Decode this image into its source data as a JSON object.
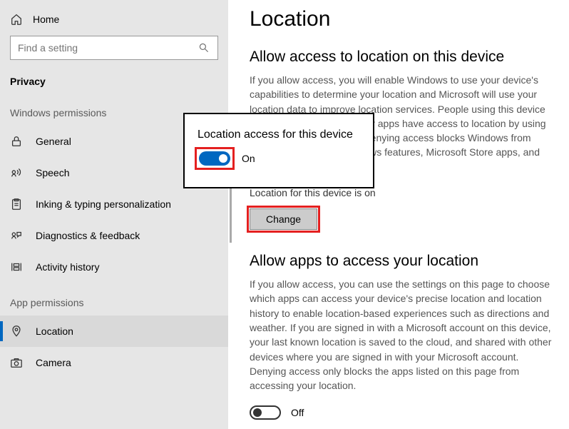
{
  "sidebar": {
    "home": "Home",
    "search_placeholder": "Find a setting",
    "section": "Privacy",
    "group1": "Windows permissions",
    "items1": [
      {
        "label": "General"
      },
      {
        "label": "Speech"
      },
      {
        "label": "Inking & typing personalization"
      },
      {
        "label": "Diagnostics & feedback"
      },
      {
        "label": "Activity history"
      }
    ],
    "group2": "App permissions",
    "items2": [
      {
        "label": "Location"
      },
      {
        "label": "Camera"
      }
    ]
  },
  "main": {
    "title": "Location",
    "section1_title": "Allow access to location on this device",
    "section1_body": "If you allow access, you will enable Windows to use your device's capabilities to determine your location and Microsoft will use your location data to improve location services. People using this device will be able to choose if their apps have access to location by using the settings on this page. Denying access blocks Windows from providing location to Windows features, Microsoft Store apps, and most desktop apps.",
    "status_line": "Location for this device is on",
    "change_btn": "Change",
    "section2_title": "Allow apps to access your location",
    "section2_body": "If you allow access, you can use the settings on this page to choose which apps can access your device's precise location and location history to enable location-based experiences such as directions and weather. If you are signed in with a Microsoft account on this device, your last known location is saved to the cloud, and shared with other devices where you are signed in with your Microsoft account. Denying access only blocks the apps listed on this page from accessing your location.",
    "toggle2_label": "Off"
  },
  "popup": {
    "title": "Location access for this device",
    "toggle_label": "On"
  }
}
